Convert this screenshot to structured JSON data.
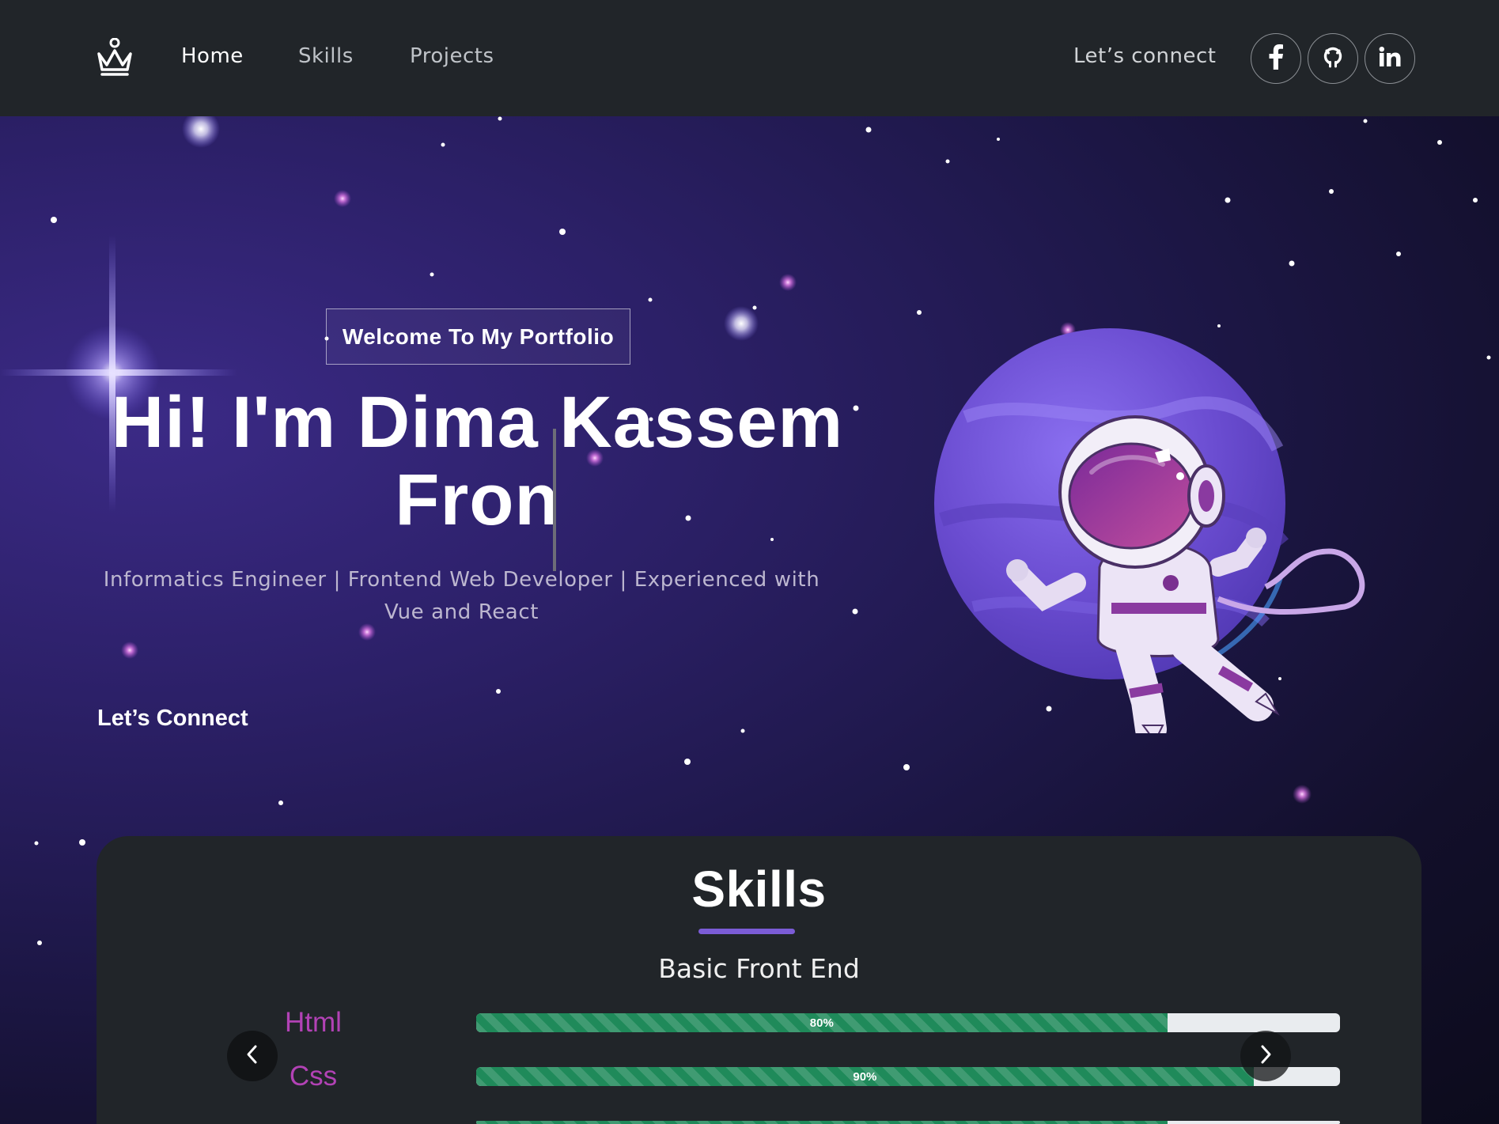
{
  "nav": {
    "logo_icon": "crown-icon",
    "links": [
      {
        "label": "Home",
        "active": true
      },
      {
        "label": "Skills",
        "active": false
      },
      {
        "label": "Projects",
        "active": false
      }
    ],
    "connect_label": "Let’s connect",
    "social": [
      {
        "icon": "facebook-icon",
        "glyph": "f"
      },
      {
        "icon": "github-icon"
      },
      {
        "icon": "linkedin-icon",
        "glyph": "in"
      }
    ]
  },
  "hero": {
    "welcome": "Welcome To My Portfolio",
    "title_line1": "Hi! I'm Dima Kassem",
    "title_line2": "Fron",
    "subtitle": "Informatics Engineer | Frontend Web Developer | Experienced with Vue and React",
    "connect_label": "Let’s Connect",
    "illustration": "astronaut-planet-illustration"
  },
  "skills": {
    "title": "Skills",
    "subtitle": "Basic Front End",
    "items": [
      {
        "name": "Html",
        "percent": 80,
        "label": "80%"
      },
      {
        "name": "Css",
        "percent": 90,
        "label": "90%"
      }
    ],
    "prev_icon": "chevron-left-icon",
    "next_icon": "chevron-right-icon"
  },
  "colors": {
    "navbar_bg": "#212529",
    "accent_purple": "#7b5cd6",
    "skill_name": "#b242b5",
    "progress_fill": "#1f8a5a",
    "card_bg": "#212529"
  }
}
